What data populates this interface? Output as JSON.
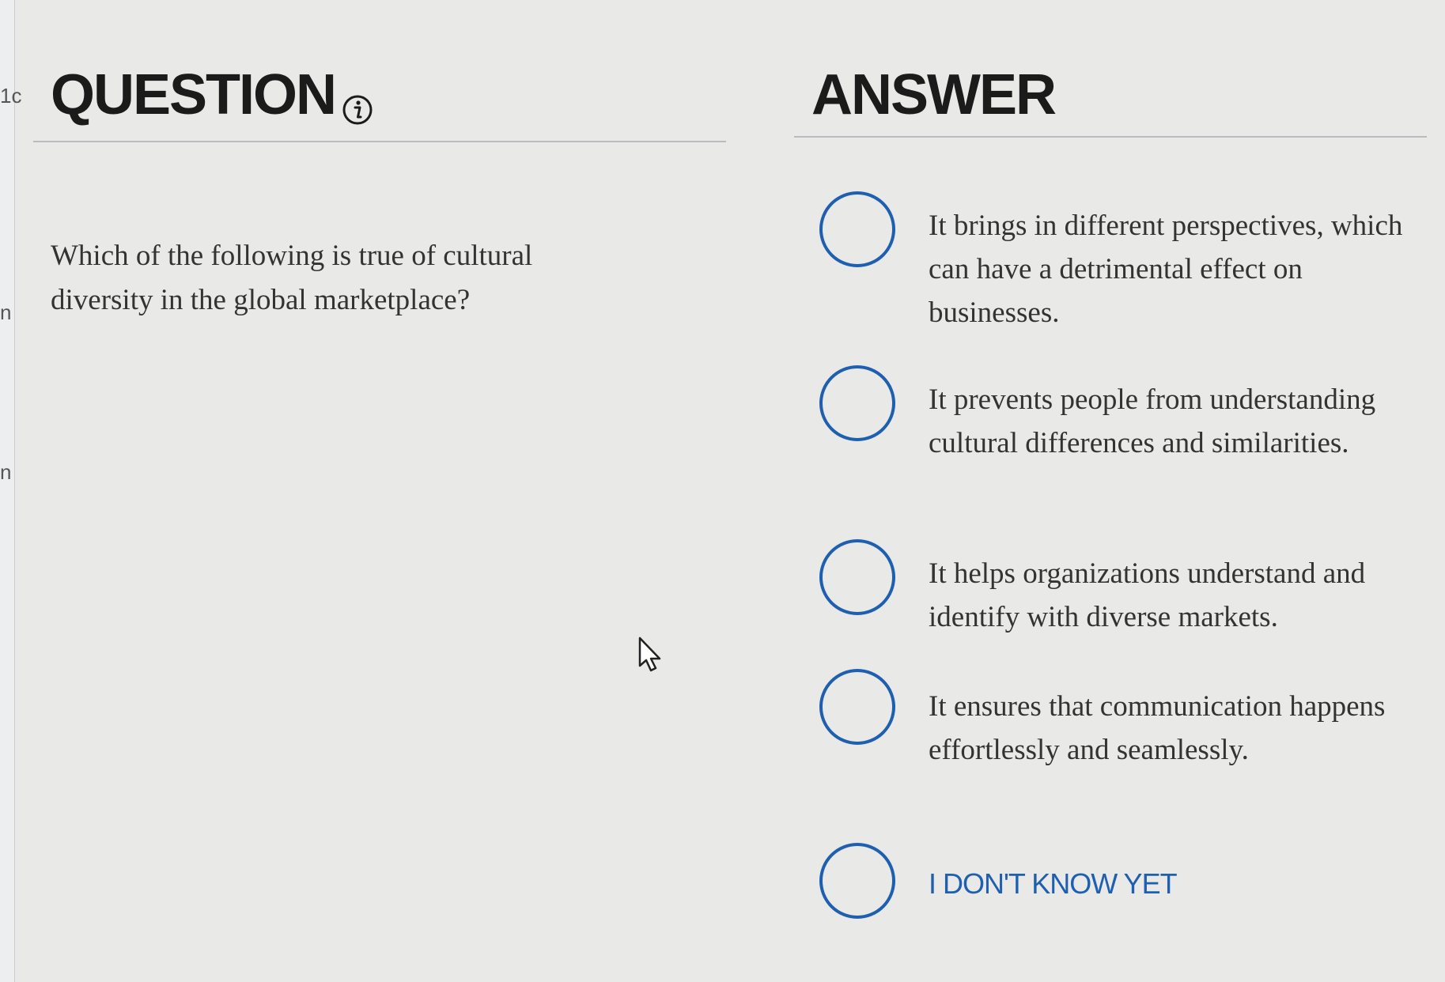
{
  "sidebar": {
    "fragments": [
      "1c",
      "n",
      "n"
    ]
  },
  "question": {
    "heading": "QUESTION",
    "text": "Which of the following is true of cultural diversity in the global marketplace?"
  },
  "answer": {
    "heading": "ANSWER",
    "choices": [
      {
        "label": "It brings in different perspectives, which can have a detrimental effect on businesses."
      },
      {
        "label": "It prevents people from understanding cultural differences and similarities."
      },
      {
        "label": "It helps organizations understand and identify with diverse markets."
      },
      {
        "label": "It ensures that communication happens effortlessly and seamlessly."
      },
      {
        "label": "I DON'T KNOW YET"
      }
    ]
  },
  "icons": {
    "info": "info-circle-icon",
    "cursor": "mouse-pointer-icon"
  },
  "colors": {
    "radio_border": "#1f5fb0",
    "idk_text": "#1f5fb0",
    "heading_text": "#1b1b1b",
    "divider": "#b9bcbe"
  }
}
